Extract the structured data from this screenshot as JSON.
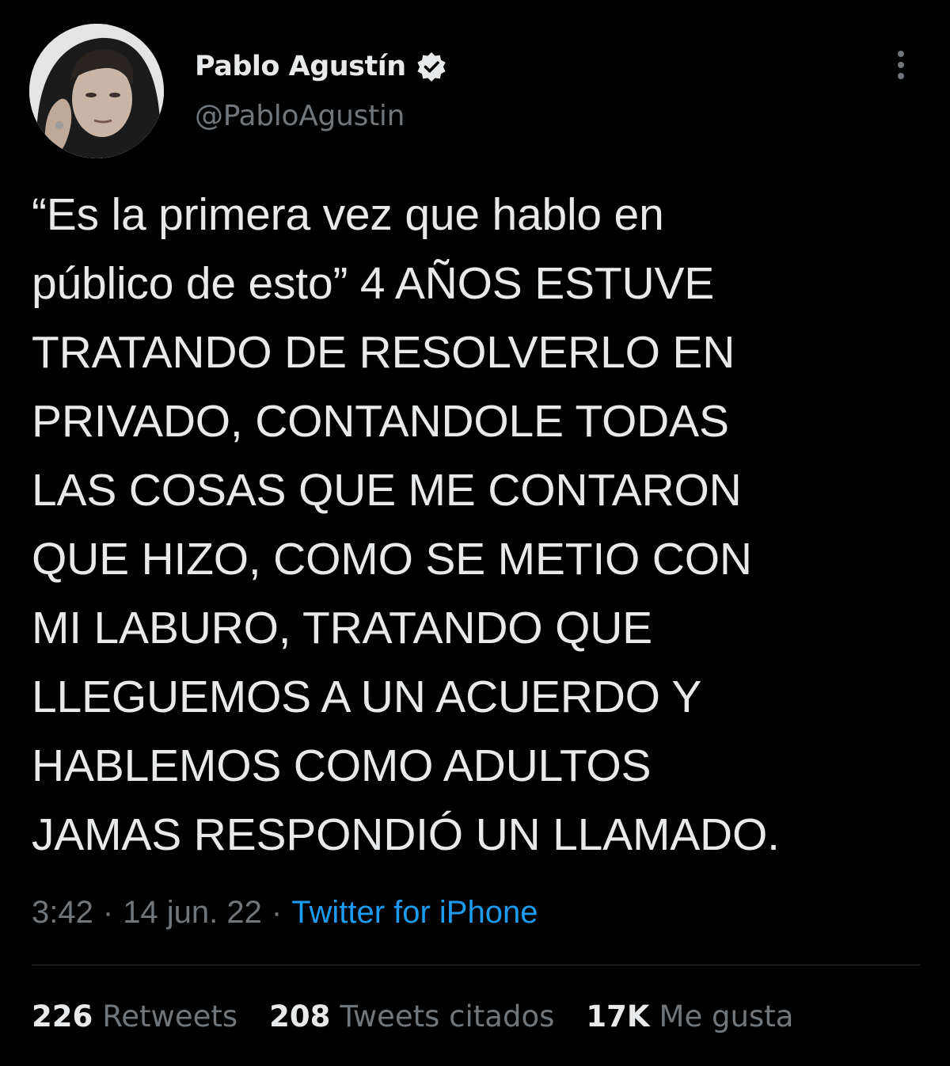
{
  "author": {
    "display_name": "Pablo Agustín",
    "handle": "@PabloAgustin",
    "verified": true,
    "avatar_icon": "profile-photo"
  },
  "tweet": {
    "text": "“Es la primera vez que hablo en\npúblico de esto” 4 AÑOS ESTUVE\nTRATANDO DE RESOLVERLO EN\nPRIVADO, CONTANDOLE TODAS\nLAS COSAS QUE ME CONTARON\nQUE HIZO, COMO SE METIO CON\nMI LABURO, TRATANDO QUE\nLLEGUEMOS A UN ACUERDO Y\nHABLEMOS COMO ADULTOS\nJAMAS RESPONDIÓ UN LLAMADO.",
    "time": "3:42",
    "date": "14 jun. 22",
    "separator": "·",
    "source": "Twitter for iPhone"
  },
  "stats": {
    "retweets": {
      "count": "226",
      "label": "Retweets"
    },
    "quotes": {
      "count": "208",
      "label": "Tweets citados"
    },
    "likes": {
      "count": "17K",
      "label": "Me gusta"
    }
  },
  "colors": {
    "background": "#000000",
    "text": "#e7e9ea",
    "secondary": "#71767b",
    "accent": "#1d9bf0",
    "divider": "#2f3336"
  },
  "icons": {
    "verified": "verified-badge-icon",
    "more": "more-options-icon"
  }
}
